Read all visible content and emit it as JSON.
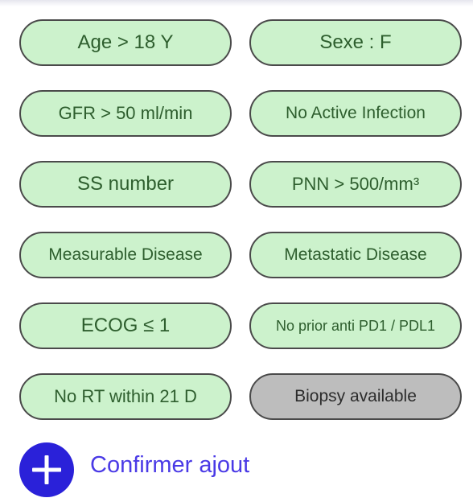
{
  "criteria": [
    {
      "label": "Age > 18 Y",
      "status": "met"
    },
    {
      "label": "Sexe : F",
      "status": "met"
    },
    {
      "label": "GFR > 50 ml/min",
      "status": "met"
    },
    {
      "label": "No Active Infection",
      "status": "met"
    },
    {
      "label": "SS number",
      "status": "met"
    },
    {
      "label": "PNN > 500/mm³",
      "status": "met"
    },
    {
      "label": "Measurable Disease",
      "status": "met"
    },
    {
      "label": "Metastatic Disease",
      "status": "met"
    },
    {
      "label": "ECOG ≤ 1",
      "status": "met"
    },
    {
      "label": "No prior anti PD1 / PDL1",
      "status": "met"
    },
    {
      "label": "No RT within 21 D",
      "status": "met"
    },
    {
      "label": "Biopsy available",
      "status": "unmet"
    }
  ],
  "confirm": {
    "label": "Confirmer ajout",
    "icon": "plus-circle-icon"
  },
  "colors": {
    "met_fill": "#ccf2cc",
    "met_text": "#2e5e2e",
    "unmet_fill": "#bdbdbd",
    "pill_border": "#4a4a4a",
    "accent": "#2a21d9",
    "confirm_text": "#4a3ae6"
  }
}
